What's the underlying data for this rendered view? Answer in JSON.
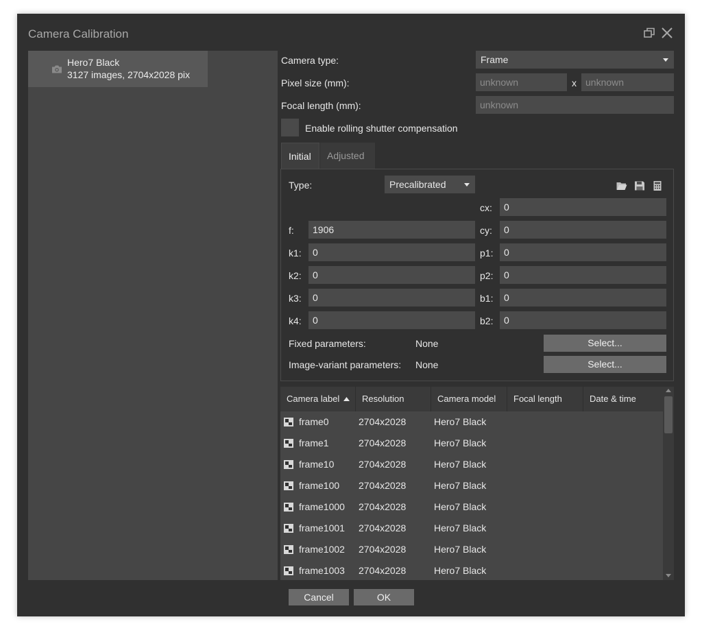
{
  "dialog": {
    "title": "Camera Calibration"
  },
  "camera_list": [
    {
      "name": "Hero7 Black",
      "info": "3127 images, 2704x2028 pix"
    }
  ],
  "settings": {
    "camera_type_label": "Camera type:",
    "camera_type_value": "Frame",
    "pixel_size_label": "Pixel size (mm):",
    "pixel_size_x_placeholder": "unknown",
    "pixel_size_sep": "x",
    "pixel_size_y_placeholder": "unknown",
    "focal_length_label": "Focal length (mm):",
    "focal_length_placeholder": "unknown",
    "rolling_shutter_label": "Enable rolling shutter compensation",
    "rolling_shutter_checked": false
  },
  "tabs": [
    {
      "label": "Initial",
      "active": true
    },
    {
      "label": "Adjusted",
      "active": false
    }
  ],
  "calibration": {
    "type_label": "Type:",
    "type_value": "Precalibrated",
    "params_left": [
      {
        "label": "f:",
        "value": "1906"
      },
      {
        "label": "k1:",
        "value": "0"
      },
      {
        "label": "k2:",
        "value": "0"
      },
      {
        "label": "k3:",
        "value": "0"
      },
      {
        "label": "k4:",
        "value": "0"
      }
    ],
    "params_right": [
      {
        "label": "cx:",
        "value": "0"
      },
      {
        "label": "cy:",
        "value": "0"
      },
      {
        "label": "p1:",
        "value": "0"
      },
      {
        "label": "p2:",
        "value": "0"
      },
      {
        "label": "b1:",
        "value": "0"
      },
      {
        "label": "b2:",
        "value": "0"
      }
    ],
    "fixed_label": "Fixed parameters:",
    "fixed_value": "None",
    "variant_label": "Image-variant parameters:",
    "variant_value": "None",
    "select_label": "Select..."
  },
  "table": {
    "columns": [
      "Camera label",
      "Resolution",
      "Camera model",
      "Focal length",
      "Date & time"
    ],
    "sort_column": "Camera label",
    "sort_direction": "ascending",
    "rows": [
      {
        "label": "frame0",
        "resolution": "2704x2028",
        "model": "Hero7 Black"
      },
      {
        "label": "frame1",
        "resolution": "2704x2028",
        "model": "Hero7 Black"
      },
      {
        "label": "frame10",
        "resolution": "2704x2028",
        "model": "Hero7 Black"
      },
      {
        "label": "frame100",
        "resolution": "2704x2028",
        "model": "Hero7 Black"
      },
      {
        "label": "frame1000",
        "resolution": "2704x2028",
        "model": "Hero7 Black"
      },
      {
        "label": "frame1001",
        "resolution": "2704x2028",
        "model": "Hero7 Black"
      },
      {
        "label": "frame1002",
        "resolution": "2704x2028",
        "model": "Hero7 Black"
      },
      {
        "label": "frame1003",
        "resolution": "2704x2028",
        "model": "Hero7 Black"
      }
    ]
  },
  "footer": {
    "cancel_label": "Cancel",
    "ok_label": "OK"
  },
  "icons": {
    "restore": "restore-window-icon",
    "close": "close-icon",
    "camera": "camera-icon",
    "open": "folder-open-icon",
    "save": "save-icon",
    "calculator": "calculator-icon",
    "frame": "image-icon"
  }
}
